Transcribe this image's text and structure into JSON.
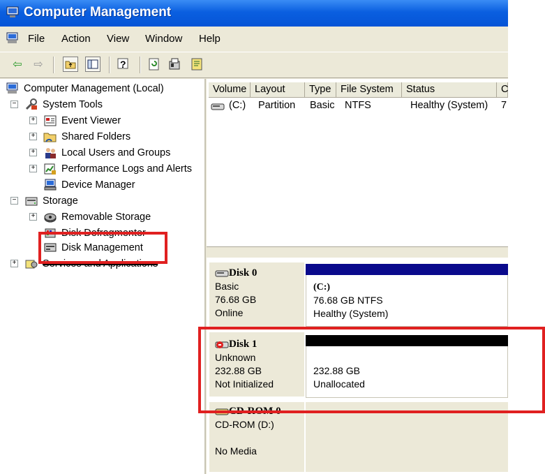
{
  "window": {
    "title": "Computer Management"
  },
  "menu": {
    "items": [
      "File",
      "Action",
      "View",
      "Window",
      "Help"
    ]
  },
  "toolbar": {
    "icons": [
      "back-arrow-icon",
      "forward-arrow-icon",
      "up-folder-icon",
      "show-hide-tree-icon",
      "help-icon",
      "refresh-icon",
      "properties-icon",
      "export-icon"
    ]
  },
  "tree": {
    "root": "Computer Management (Local)",
    "system_tools": "System Tools",
    "event_viewer": "Event Viewer",
    "shared_folders": "Shared Folders",
    "local_users": "Local Users and Groups",
    "perf_logs": "Performance Logs and Alerts",
    "device_manager": "Device Manager",
    "storage": "Storage",
    "removable_storage": "Removable Storage",
    "disk_defrag": "Disk Defragmenter",
    "disk_management": "Disk Management",
    "services_apps": "Services and Applications"
  },
  "volume_list": {
    "headers": [
      "Volume",
      "Layout",
      "Type",
      "File System",
      "Status",
      "C"
    ],
    "rows": [
      {
        "volume": "(C:)",
        "layout": "Partition",
        "type": "Basic",
        "fs": "NTFS",
        "status": "Healthy (System)",
        "extra": "7"
      }
    ]
  },
  "disks": [
    {
      "name": "Disk 0",
      "type": "Basic",
      "size": "76.68 GB",
      "state": "Online",
      "partition": {
        "label": "(C:)",
        "detail": "76.68 GB NTFS",
        "status": "Healthy (System)"
      },
      "bar_color": "#0a0a8c"
    },
    {
      "name": "Disk 1",
      "type": "Unknown",
      "size": "232.88 GB",
      "state": "Not Initialized",
      "partition": {
        "detail": "232.88 GB",
        "status": "Unallocated"
      },
      "bar_color": "#000000"
    },
    {
      "name": "CD-ROM 0",
      "type": "CD-ROM (D:)",
      "state": "No Media"
    }
  ],
  "highlight_color": "#e02020"
}
